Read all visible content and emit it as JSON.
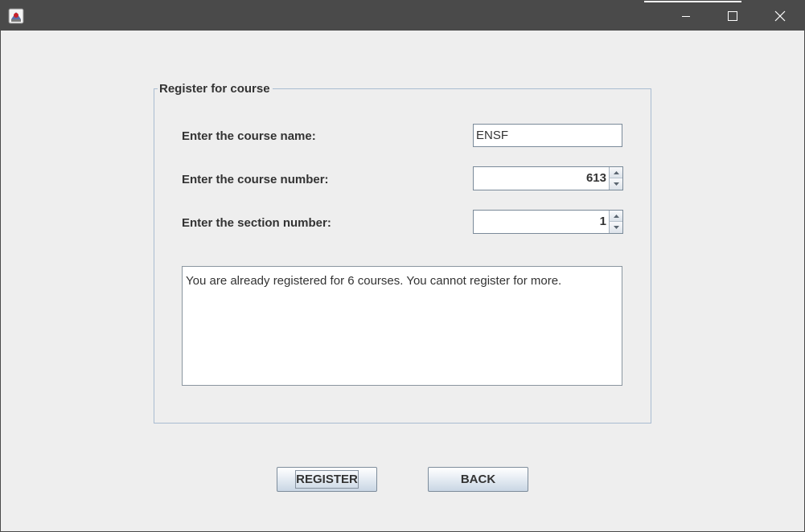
{
  "window": {
    "icon": "java-app-icon",
    "controls": [
      "minimize-icon",
      "maximize-icon",
      "close-icon"
    ]
  },
  "form": {
    "group_title": "Register for course",
    "course_name_label": "Enter the course name:",
    "course_name_value": "ENSF",
    "course_number_label": "Enter the course number:",
    "course_number_value": "613",
    "section_number_label": "Enter the section number:",
    "section_number_value": "1",
    "message": "You are already registered for 6 courses. You cannot register for more."
  },
  "buttons": {
    "register_label": "REGISTER",
    "back_label": "BACK"
  },
  "colors": {
    "titlebar": "#4a4a4a",
    "background": "#eeeeee",
    "group_border": "#a9bcd1"
  }
}
